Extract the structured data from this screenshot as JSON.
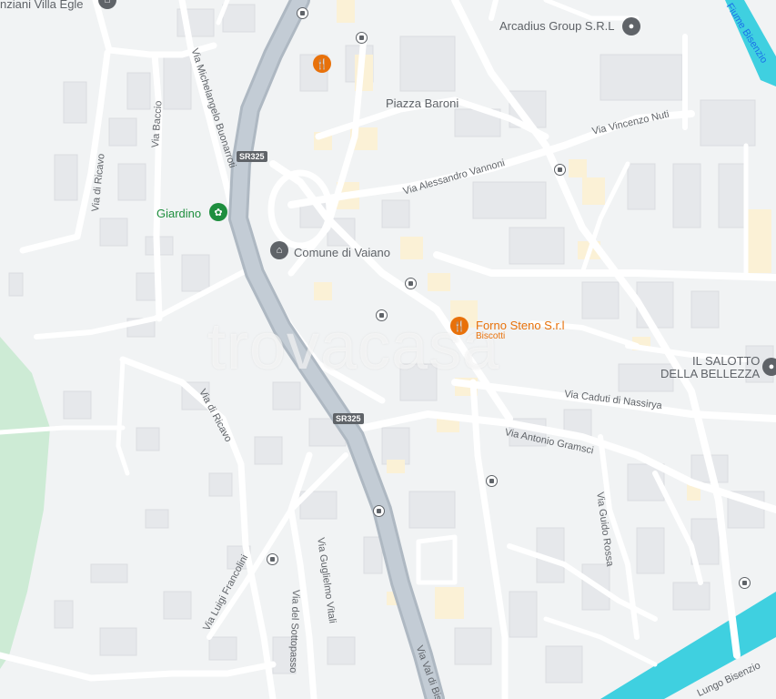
{
  "places": {
    "villa": "nziani Villa Egle",
    "arcadius": "Arcadius Group S.R.L",
    "piazza": "Piazza Baroni",
    "giardino": "Giardino",
    "comune": "Comune di Vaiano",
    "forno": "Forno Steno S.r.l",
    "forno_sub": "Biscotti",
    "salotto_1": "IL SALOTTO",
    "salotto_2": "DELLA BELLEZZA"
  },
  "streets": {
    "bisenzio_top": "Fiume Bisenzio",
    "nuti": "Via Vincenzo Nuti",
    "vannoni": "Via Alessandro Vannoni",
    "buonarroti": "Via Michelangelo Buonarroti",
    "baccio": "Via Baccio",
    "ricavo_top": "Via di Ricavo",
    "ricavo_mid": "Via di Ricavo",
    "nassirya": "Via Caduti di Nassirya",
    "gramsci": "Via Antonio Gramsci",
    "guido_rossa": "Via Guido Rossa",
    "francolini": "Via Luigi Francolini",
    "guglielmo": "Via Guglielmo Vitali",
    "sotto": "Via del Sottopasso",
    "valdi": "Via Val di Bisenzio",
    "lungo": "Lungo Bisenzio"
  },
  "shields": {
    "sr325_a": "SR325",
    "sr325_b": "SR325"
  },
  "watermark": "trovacasa",
  "colors": {
    "road": "#ffffff",
    "main_road": "#aab4be",
    "water": "#3fd0e0",
    "park": "#cdebd5",
    "building": "#e8eaed",
    "poi_orange": "#e8710a",
    "poi_green": "#1e8e3e",
    "poi_gray": "#5f6368"
  }
}
